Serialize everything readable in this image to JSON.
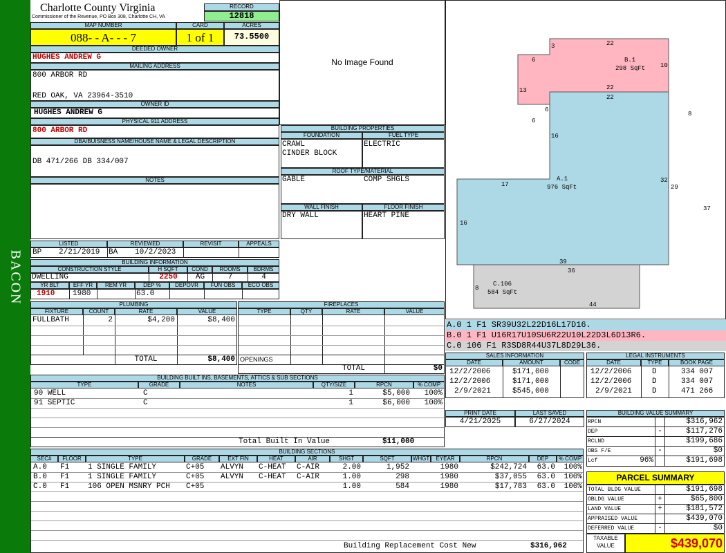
{
  "sidebar": {
    "label": "BACON"
  },
  "header": {
    "county": "Charlotte County Virginia",
    "commissioner": "Commissioner of the Revenue, PO Box 308, Charlotte CH, VA",
    "record_label": "RECORD",
    "record": "12818",
    "map_label": "MAP NUMBER",
    "map_number": "088- - A- - - 7",
    "card_label": "CARD",
    "card": "1 of 1",
    "acres_label": "ACRES",
    "acres": "73.5500"
  },
  "owner": {
    "deeded_label": "DEEDED OWNER",
    "deeded": "HUGHES ANDREW G",
    "mailing_label": "MAILING ADDRESS",
    "addr1": "800 ARBOR RD",
    "addr2": "RED OAK, VA 23964-3510",
    "owner_id_label": "OWNER ID",
    "owner_id": "HUGHES ANDREW G",
    "physical_label": "PHYSICAL 911 ADDRESS",
    "physical": "800 ARBOR RD"
  },
  "legal": {
    "label": "DBA/BUISNESS NAME/HOUSE NAME & LEGAL DESCRIPTION",
    "text": "DB 471/266 DB 334/007"
  },
  "notes": {
    "label": "NOTES"
  },
  "photo": {
    "text": "No Image Found"
  },
  "props": {
    "title": "BUILDING PROPERTIES",
    "foundation_label": "FOUNDATION",
    "fuel_label": "FUEL TYPE",
    "foundation1": "CRAWL",
    "foundation2": "CINDER BLOCK",
    "fuel": "ELECTRIC",
    "roof_label": "ROOF TYPE/MATERIAL",
    "roof_type": "GABLE",
    "roof_mat": "COMP SHGLS",
    "wall_label": "WALL FINISH",
    "floor_label": "FLOOR FINISH",
    "wall": "DRY WALL",
    "floor": "HEART PINE"
  },
  "status": {
    "listed_label": "LISTED",
    "reviewed_label": "REVIEWED",
    "revisit_label": "REVISIT",
    "appeals_label": "APPEALS",
    "listed_code": "BP",
    "listed_date": "2/21/2019",
    "reviewed_code": "BA",
    "reviewed_date": "10/2/2023"
  },
  "building": {
    "title": "BUILDING INFORMATION",
    "cs_label": "CONSTRUCTION STYLE",
    "hsqft_label": "H SQFT",
    "cond_label": "COND",
    "rooms_label": "ROOMS",
    "bdrms_label": "BDRMS",
    "style": "DWELLING",
    "hsqft": "2250",
    "cond": "AG",
    "rooms": "7",
    "bdrms": "4",
    "yrblt_label": "YR BLT",
    "effyr_label": "EFF YR",
    "remyr_label": "REM YR",
    "dep_label": "DEP %",
    "depovr_label": "DEPOVR",
    "funobs_label": "FUN OBS",
    "ecoobs_label": "ECO OBS",
    "yrblt": "1910",
    "effyr": "1980",
    "dep": "63.0"
  },
  "plumbing": {
    "title": "PLUMBING",
    "headers": [
      "FIXTURE",
      "COUNT",
      "RATE",
      "VALUE"
    ],
    "rows": [
      [
        "FULLBATH",
        "2",
        "$4,200",
        "$8,400"
      ]
    ],
    "total_label": "TOTAL",
    "total": "$8,400"
  },
  "fireplaces": {
    "title": "FIREPLACES",
    "headers": [
      "TYPE",
      "QTY",
      "RATE",
      "VALUE"
    ],
    "openings_label": "OPENINGS",
    "total_label": "TOTAL",
    "total": "$0"
  },
  "builtins": {
    "title": "BUILDING BUILT INS, BASEMENTS, ATTICS & SUB SECTIONS",
    "headers": [
      "TYPE",
      "GRADE",
      "NOTES",
      "QTY/SIZE",
      "RPCN",
      "% COMP"
    ],
    "rows": [
      [
        "90 WELL",
        "C",
        "",
        "1",
        "$5,000",
        "100%"
      ],
      [
        "91 SEPTIC",
        "C",
        "",
        "1",
        "$6,000",
        "100%"
      ]
    ],
    "total_label": "Total Built In Value",
    "total": "$11,000"
  },
  "sections": {
    "title": "BUILDING SECTIONS",
    "headers": [
      "SEC#",
      "FLOOR",
      "TYPE",
      "GRADE",
      "EXT FIN",
      "HEAT",
      "AIR",
      "SHGT",
      "SQFT",
      "WHGT",
      "EYEAR",
      "RPCN",
      "DEP",
      "% COMP"
    ],
    "rows": [
      [
        "A.0",
        "F1",
        "1 SINGLE FAMILY",
        "C+05",
        "ALVYN",
        "C-HEAT",
        "C-AIR",
        "2.00",
        "1,952",
        "",
        "1980",
        "$242,724",
        "63.0",
        "100%"
      ],
      [
        "B.0",
        "F1",
        "1 SINGLE FAMILY",
        "C+05",
        "ALVYN",
        "C-HEAT",
        "C-AIR",
        "1.00",
        "298",
        "",
        "1980",
        "$37,055",
        "63.0",
        "100%"
      ],
      [
        "C.0",
        "F1",
        "106 OPEN MSNRY PCH",
        "C+05",
        "",
        "",
        "",
        "1.00",
        "584",
        "",
        "1980",
        "$17,783",
        "63.0",
        "100%"
      ]
    ],
    "brcn_label": "Building Replacement Cost New",
    "brcn": "$316,962"
  },
  "sketch": {
    "sections": [
      {
        "label": "A.1",
        "area": "976 SqFt",
        "color": "#add8e6"
      },
      {
        "label": "B.1",
        "area": "298 SqFt",
        "color": "#ffb6c1"
      },
      {
        "label": "C.106",
        "area": "584 SqFt",
        "color": "#d3d3d3"
      }
    ],
    "dims": [
      "3",
      "22",
      "6",
      "10",
      "13",
      "22",
      "22",
      "6",
      "6",
      "16",
      "8",
      "32",
      "29",
      "17",
      "37",
      "16",
      "39",
      "36",
      "8",
      "44"
    ]
  },
  "segments": [
    {
      "text": "A.0  1    F1   SR39U32L22D16L17D16.",
      "color": "#add8e6"
    },
    {
      "text": "B.0  1    F1   U16R17U10SU6R22U10L22D3L6D13R6.",
      "color": "#ffb6c1"
    },
    {
      "text": "C.0  106  F1   R3SD8R44U37L8D29L36.",
      "color": "#d3d3d3"
    }
  ],
  "sales": {
    "title": "SALES INFORMATION",
    "headers": [
      "DATE",
      "AMOUNT",
      "CODE"
    ],
    "rows": [
      [
        "12/2/2006",
        "$171,000",
        ""
      ],
      [
        "12/2/2006",
        "$171,000",
        ""
      ],
      [
        "2/9/2021",
        "$545,000",
        ""
      ]
    ]
  },
  "legal_inst": {
    "title": "LEGAL INSTRUMENTS",
    "headers": [
      "DATE",
      "TYPE",
      "BOOK PAGE"
    ],
    "rows": [
      [
        "12/2/2006",
        "D",
        "334 007"
      ],
      [
        "12/2/2006",
        "D",
        "334 007"
      ],
      [
        "2/9/2021",
        "D",
        "471 266"
      ]
    ]
  },
  "print": {
    "print_label": "PRINT DATE",
    "print_date": "4/21/2025",
    "saved_label": "LAST SAVED",
    "saved_date": "6/27/2024"
  },
  "bvs": {
    "title": "BUILDING VALUE SUMMARY",
    "rows": [
      {
        "label": "RPCN",
        "sign": "",
        "value": "$316,962"
      },
      {
        "label": "DEP",
        "sign": "-",
        "value": "$117,276"
      },
      {
        "label": "RCLND",
        "sign": "",
        "value": "$199,686"
      },
      {
        "label": "OBS F/E",
        "sign": "-",
        "value": "$0"
      },
      {
        "label": "Lcf",
        "pct": "96%",
        "sign": "",
        "value": "$191,698"
      }
    ]
  },
  "parcel": {
    "title": "PARCEL SUMMARY",
    "rows": [
      {
        "label": "TOTAL BLDG VALUE",
        "sign": "",
        "value": "$191,698"
      },
      {
        "label": "OBLDG VALUE",
        "sign": "+",
        "value": "$65,800"
      },
      {
        "label": "LAND VALUE",
        "sign": "+",
        "value": "$181,572"
      },
      {
        "label": "APPRAISED VALUE",
        "sign": "",
        "value": "$439,070"
      },
      {
        "label": "DEFERRED VALUE",
        "sign": "-",
        "value": "$0"
      }
    ],
    "taxable_label1": "TAXABLE",
    "taxable_label2": "VALUE",
    "taxable": "$439,070"
  }
}
